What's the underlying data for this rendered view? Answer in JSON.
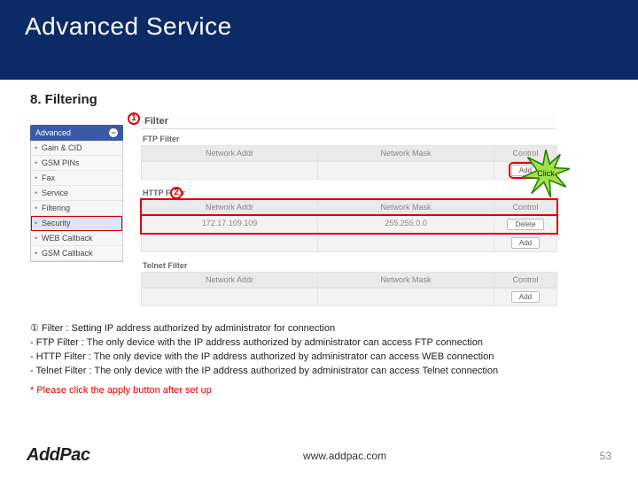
{
  "title": "Advanced Service",
  "section": "8. Filtering",
  "markers": {
    "m1": "1",
    "m2": "2"
  },
  "sidebar": {
    "heading": "Advanced",
    "items": [
      {
        "label": "Gain & CID"
      },
      {
        "label": "GSM PINs"
      },
      {
        "label": "Fax"
      },
      {
        "label": "Service"
      },
      {
        "label": "Filtering"
      },
      {
        "label": "Security",
        "selected": true
      },
      {
        "label": "WEB Callback"
      },
      {
        "label": "GSM Callback"
      }
    ]
  },
  "panel": {
    "title": "Filter",
    "columns": {
      "addr": "Network Addr",
      "mask": "Network Mask",
      "control": "Control"
    },
    "buttons": {
      "add": "Add",
      "delete": "Delete"
    },
    "ftp": {
      "title": "FTP Filter"
    },
    "http": {
      "title": "HTTP Filter",
      "row": {
        "addr": "172.17.109.109",
        "mask": "255.255.0.0"
      }
    },
    "telnet": {
      "title": "Telnet Filter"
    }
  },
  "starburst": "Click",
  "notes": {
    "l1": "① Filter : Setting IP address authorized by administrator for connection",
    "l2": "- FTP Filter : The only device with the IP address authorized by administrator can access FTP connection",
    "l3": "- HTTP Filter : The only device with the IP address authorized by administrator can access WEB connection",
    "l4": "- Telnet Filter : The only device with the IP address authorized by administrator can access Telnet connection",
    "warn": "* Please click the apply button after set up"
  },
  "footer": {
    "logo": "AddPac",
    "url": "www.addpac.com",
    "page": "53"
  }
}
